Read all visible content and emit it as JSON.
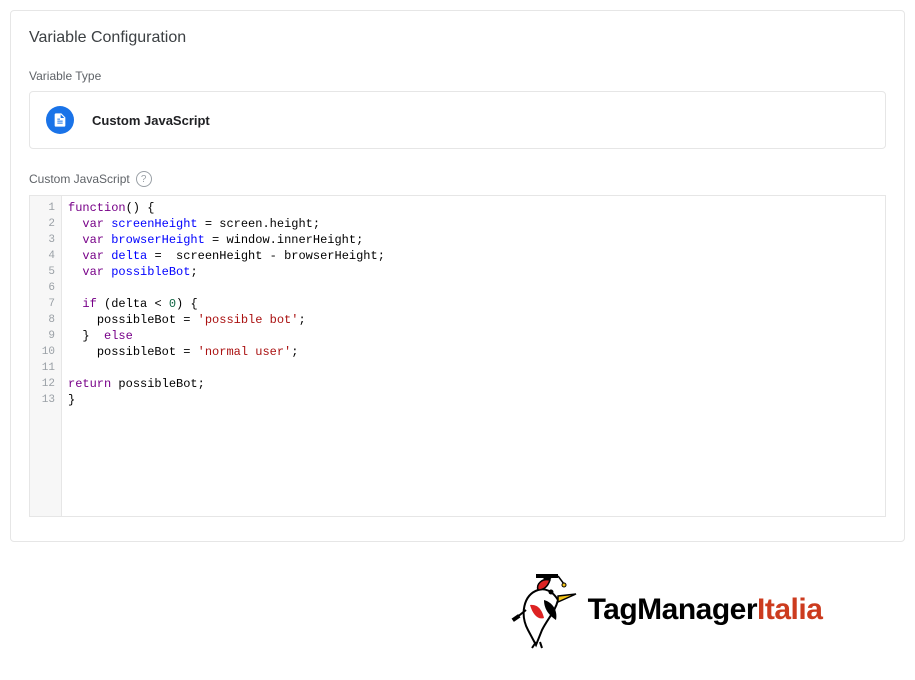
{
  "panel": {
    "title": "Variable Configuration",
    "type_label": "Variable Type",
    "variable_type": "Custom JavaScript",
    "editor_label": "Custom JavaScript",
    "help_glyph": "?"
  },
  "code": {
    "lines": [
      [
        [
          "kw",
          "function"
        ],
        [
          "punc",
          "() {"
        ]
      ],
      [
        [
          "indent",
          "  "
        ],
        [
          "kw",
          "var"
        ],
        [
          "sp",
          " "
        ],
        [
          "def",
          "screenHeight"
        ],
        [
          "sp",
          " "
        ],
        [
          "punc",
          "="
        ],
        [
          "sp",
          " "
        ],
        [
          "var",
          "screen"
        ],
        [
          "punc",
          "."
        ],
        [
          "prop",
          "height"
        ],
        [
          "punc",
          ";"
        ]
      ],
      [
        [
          "indent",
          "  "
        ],
        [
          "kw",
          "var"
        ],
        [
          "sp",
          " "
        ],
        [
          "def",
          "browserHeight"
        ],
        [
          "sp",
          " "
        ],
        [
          "punc",
          "="
        ],
        [
          "sp",
          " "
        ],
        [
          "var",
          "window"
        ],
        [
          "punc",
          "."
        ],
        [
          "prop",
          "innerHeight"
        ],
        [
          "punc",
          ";"
        ]
      ],
      [
        [
          "indent",
          "  "
        ],
        [
          "kw",
          "var"
        ],
        [
          "sp",
          " "
        ],
        [
          "def",
          "delta"
        ],
        [
          "sp",
          " "
        ],
        [
          "punc",
          "="
        ],
        [
          "sp",
          "  "
        ],
        [
          "var",
          "screenHeight"
        ],
        [
          "sp",
          " "
        ],
        [
          "punc",
          "-"
        ],
        [
          "sp",
          " "
        ],
        [
          "var",
          "browserHeight"
        ],
        [
          "punc",
          ";"
        ]
      ],
      [
        [
          "indent",
          "  "
        ],
        [
          "kw",
          "var"
        ],
        [
          "sp",
          " "
        ],
        [
          "def",
          "possibleBot"
        ],
        [
          "punc",
          ";"
        ]
      ],
      [],
      [
        [
          "indent",
          "  "
        ],
        [
          "kw",
          "if"
        ],
        [
          "sp",
          " "
        ],
        [
          "punc",
          "("
        ],
        [
          "var",
          "delta"
        ],
        [
          "sp",
          " "
        ],
        [
          "punc",
          "<"
        ],
        [
          "sp",
          " "
        ],
        [
          "num",
          "0"
        ],
        [
          "punc",
          ") {"
        ]
      ],
      [
        [
          "indent",
          "    "
        ],
        [
          "var",
          "possibleBot"
        ],
        [
          "sp",
          " "
        ],
        [
          "punc",
          "="
        ],
        [
          "sp",
          " "
        ],
        [
          "str",
          "'possible bot'"
        ],
        [
          "punc",
          ";"
        ]
      ],
      [
        [
          "indent",
          "  "
        ],
        [
          "punc",
          "}"
        ],
        [
          "sp",
          "  "
        ],
        [
          "kw",
          "else"
        ]
      ],
      [
        [
          "indent",
          "    "
        ],
        [
          "var",
          "possibleBot"
        ],
        [
          "sp",
          " "
        ],
        [
          "punc",
          "="
        ],
        [
          "sp",
          " "
        ],
        [
          "str",
          "'normal user'"
        ],
        [
          "punc",
          ";"
        ]
      ],
      [],
      [
        [
          "kw",
          "return"
        ],
        [
          "sp",
          " "
        ],
        [
          "var",
          "possibleBot"
        ],
        [
          "punc",
          ";"
        ]
      ],
      [
        [
          "punc",
          "}"
        ]
      ]
    ]
  },
  "brand": {
    "tag": "TagManager",
    "italia": "Italia"
  }
}
